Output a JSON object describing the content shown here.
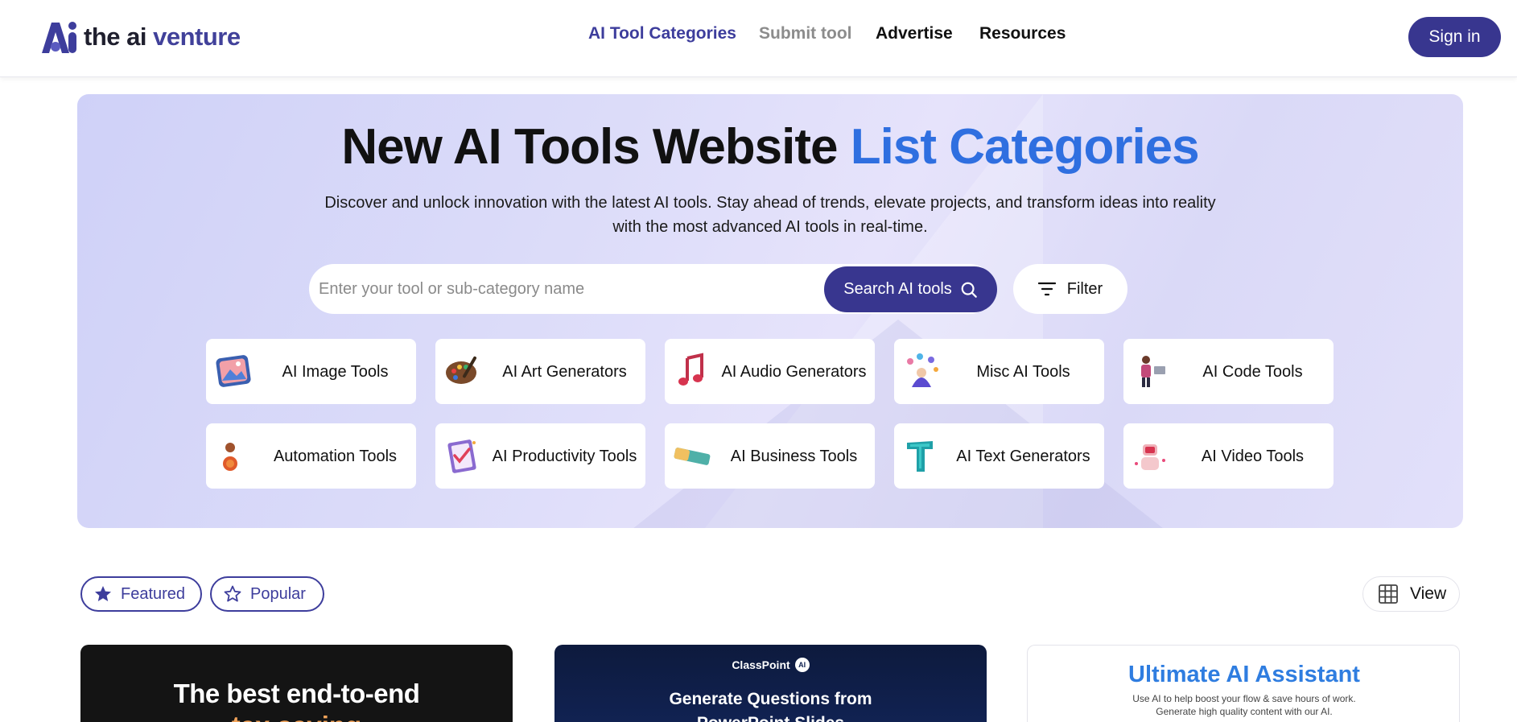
{
  "header": {
    "logo": {
      "word1": "the ai",
      "word2": "venture"
    },
    "nav": {
      "categories": "AI Tool Categories",
      "submit": "Submit tool",
      "advertise": "Advertise",
      "resources": "Resources"
    },
    "signin_label": "Sign in"
  },
  "hero": {
    "title_part1": "New AI Tools Website",
    "title_part2": "List Categories",
    "description": "Discover and unlock innovation with the latest AI tools. Stay ahead of trends, elevate projects, and transform ideas into reality with the most advanced AI tools in real-time.",
    "search": {
      "placeholder": "Enter your tool or sub-category name",
      "value": "",
      "button_label": "Search AI tools"
    },
    "filter_label": "Filter",
    "categories": [
      {
        "label": "AI Image Tools",
        "icon": "image-icon"
      },
      {
        "label": "AI Art Generators",
        "icon": "palette-icon"
      },
      {
        "label": "AI Audio Generators",
        "icon": "music-note-icon"
      },
      {
        "label": "Misc AI Tools",
        "icon": "misc-icon"
      },
      {
        "label": "AI Code Tools",
        "icon": "coder-icon"
      },
      {
        "label": "Automation Tools",
        "icon": "automation-icon"
      },
      {
        "label": "AI Productivity Tools",
        "icon": "clipboard-icon"
      },
      {
        "label": "AI Business Tools",
        "icon": "business-icon"
      },
      {
        "label": "AI Text Generators",
        "icon": "text-t-icon"
      },
      {
        "label": "AI Video Tools",
        "icon": "video-icon"
      }
    ]
  },
  "tabs": {
    "featured": "Featured",
    "popular": "Popular",
    "view": "View"
  },
  "tool_cards": [
    {
      "headline": "The best end-to-end",
      "subline": "tax saving"
    },
    {
      "brand": "ClassPoint",
      "badge": "AI",
      "headline": "Generate Questions from",
      "subline": "PowerPoint Slides"
    },
    {
      "headline": "Ultimate AI Assistant",
      "subline": "Use AI to help boost your flow & save hours of work. Generate high quality content with our AI."
    }
  ],
  "colors": {
    "brand": "#38368f",
    "accent_blue": "#2f6fe0",
    "hero_bg": "#dcdcf9"
  }
}
